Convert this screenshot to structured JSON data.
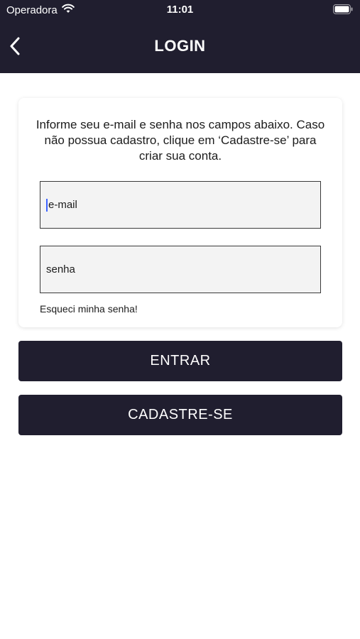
{
  "status_bar": {
    "carrier": "Operadora",
    "time": "11:01"
  },
  "nav": {
    "title": "LOGIN"
  },
  "card": {
    "instructions": "Informe seu e-mail e senha nos campos abaixo. Caso não possua cadastro, clique em ‘Cadastre-se’ para criar sua conta.",
    "email_placeholder": "e-mail",
    "password_placeholder": "senha",
    "forgot_label": "Esqueci minha senha!"
  },
  "buttons": {
    "enter_label": "ENTRAR",
    "register_label": "CADASTRE-SE"
  },
  "colors": {
    "primary": "#201e2f",
    "caret": "#3d63ff"
  }
}
